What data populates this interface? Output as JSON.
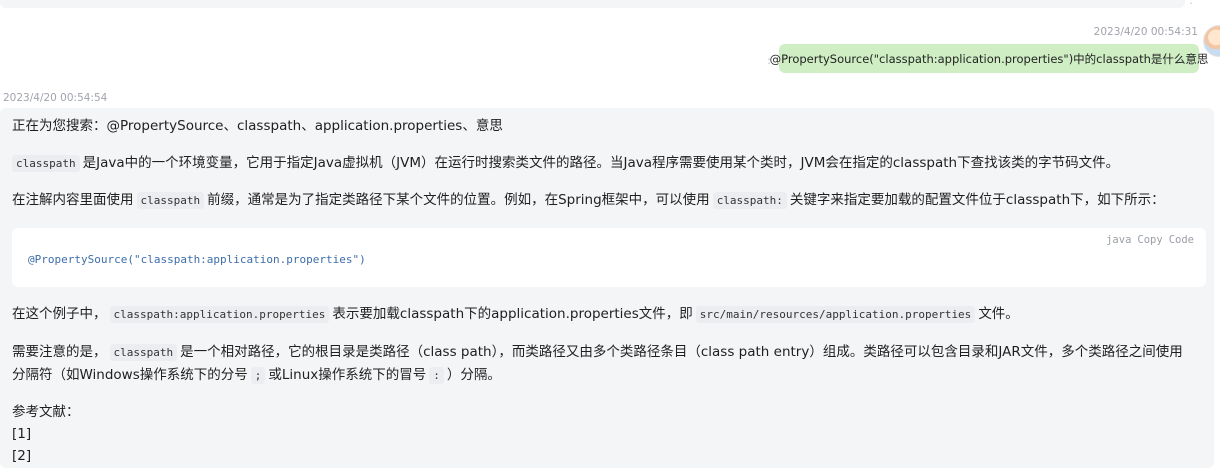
{
  "user_message": {
    "timestamp": "2023/4/20 00:54:31",
    "text": "@PropertySource(\"classpath:application.properties\")中的classpath是什么意思"
  },
  "bot_message": {
    "timestamp": "2023/4/20 00:54:54",
    "searching": "正在为您搜索：@PropertySource、classpath、application.properties、意思",
    "para1": {
      "code": "classpath",
      "text": "是Java中的一个环境变量，它用于指定Java虚拟机（JVM）在运行时搜索类文件的路径。当Java程序需要使用某个类时，JVM会在指定的classpath下查找该类的字节码文件。"
    },
    "para2": {
      "t1": "在注解内容里面使用",
      "code1": "classpath",
      "t2": "前缀，通常是为了指定类路径下某个文件的位置。例如，在Spring框架中，可以使用",
      "code2": "classpath:",
      "t3": "关键字来指定要加载的配置文件位于classpath下，如下所示："
    },
    "code_block": {
      "language": "java",
      "copy_label": "Copy",
      "code_label": "Code",
      "line": "@PropertySource(\"classpath:application.properties\")"
    },
    "para3": {
      "t1": "在这个例子中，",
      "code1": "classpath:application.properties",
      "t2": "表示要加载classpath下的application.properties文件，即",
      "code2": "src/main/resources/application.properties",
      "t3": "文件。"
    },
    "para4": {
      "t1": "需要注意的是，",
      "code1": "classpath",
      "t2": "是一个相对路径，它的根目录是类路径（class path），而类路径又由多个类路径条目（class path entry）组成。类路径可以包含目录和JAR文件，多个类路径之间使用",
      "line2_t1": "分隔符（如Windows操作系统下的分号",
      "code2": ";",
      "line2_t2": "或Linux操作系统下的冒号",
      "code3": ":",
      "line2_t3": "）分隔。"
    },
    "refs_title": "参考文献：",
    "refs": [
      "[1]",
      "[2]"
    ]
  },
  "colors": {
    "user_bubble": "#cfeec4",
    "bot_card": "#f4f5f7",
    "code_text": "#3d6da8"
  }
}
